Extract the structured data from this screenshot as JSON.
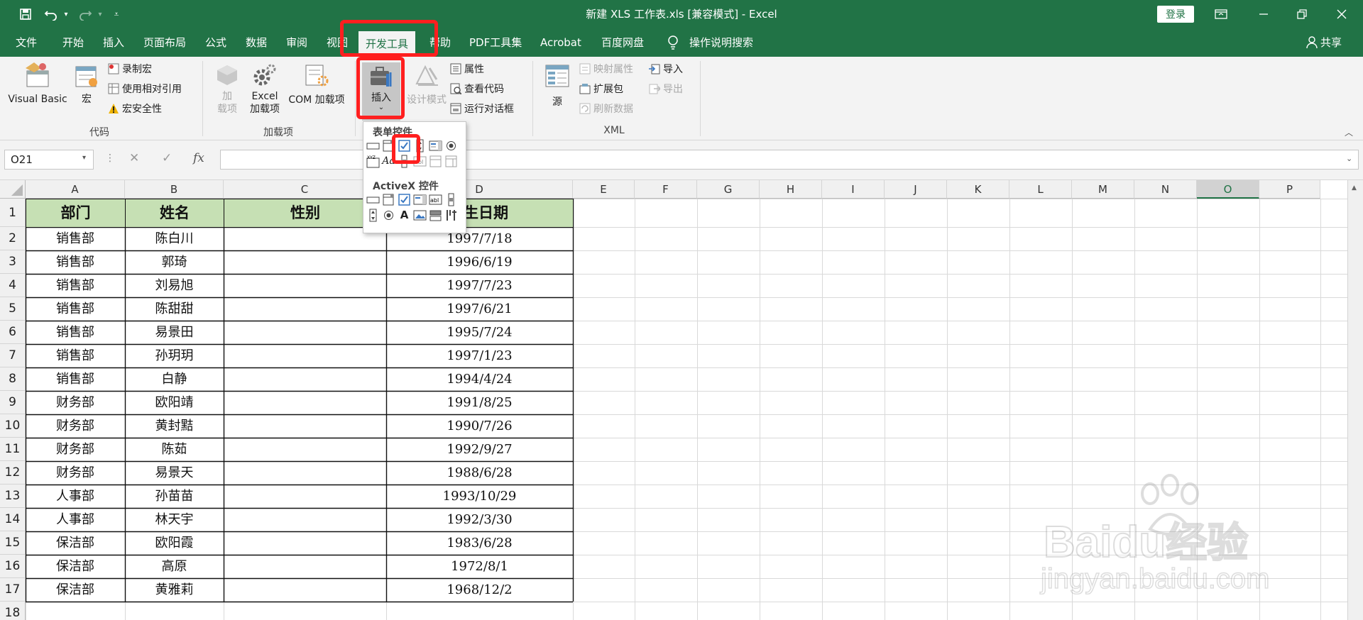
{
  "title_bar": {
    "title": "新建 XLS 工作表.xls  [兼容模式]  -  Excel",
    "login_label": "登录"
  },
  "tabs": [
    "文件",
    "开始",
    "插入",
    "页面布局",
    "公式",
    "数据",
    "审阅",
    "视图",
    "开发工具",
    "帮助",
    "PDF工具集",
    "Acrobat",
    "百度网盘",
    "操作说明搜索"
  ],
  "share_label": "共享",
  "ribbon": {
    "code_group": {
      "label": "代码",
      "visual_basic": "Visual Basic",
      "macro": "宏",
      "record_macro": "录制宏",
      "relative_ref": "使用相对引用",
      "macro_security": "宏安全性"
    },
    "addins_group": {
      "label": "加载项",
      "addins_l1": "加",
      "addins_l2": "载项",
      "excel_addins_l1": "Excel",
      "excel_addins_l2": "加载项",
      "com_addins": "COM 加载项"
    },
    "controls_group": {
      "insert": "插入",
      "design_mode": "设计模式",
      "properties": "属性",
      "view_code": "查看代码",
      "run_dialog": "运行对话框"
    },
    "xml_group": {
      "label": "XML",
      "source": "源",
      "map_properties": "映射属性",
      "expansion_packs": "扩展包",
      "refresh_data": "刷新数据",
      "import": "导入",
      "export": "导出"
    }
  },
  "formula_bar": {
    "name_box": "O21",
    "fx_label": "fx",
    "value": ""
  },
  "insert_menu": {
    "form_controls_title": "表单控件",
    "activex_title": "ActiveX 控件"
  },
  "columns": [
    "A",
    "B",
    "C",
    "D",
    "E",
    "F",
    "G",
    "H",
    "I",
    "J",
    "K",
    "L",
    "M",
    "N",
    "O",
    "P"
  ],
  "selected_column": "O",
  "row_numbers": [
    "1",
    "2",
    "3",
    "4",
    "5",
    "6",
    "7",
    "8",
    "9",
    "10",
    "11",
    "12",
    "13",
    "14",
    "15",
    "16",
    "17",
    "18"
  ],
  "table": {
    "headers": [
      "部门",
      "姓名",
      "性别",
      "出生日期"
    ],
    "header_visible": {
      "D": "生日期"
    },
    "rows": [
      [
        "销售部",
        "陈白川",
        "",
        "1997/7/18"
      ],
      [
        "销售部",
        "郭琦",
        "",
        "1996/6/19"
      ],
      [
        "销售部",
        "刘易旭",
        "",
        "1997/7/23"
      ],
      [
        "销售部",
        "陈甜甜",
        "",
        "1997/6/21"
      ],
      [
        "销售部",
        "易景田",
        "",
        "1995/7/24"
      ],
      [
        "销售部",
        "孙玥玥",
        "",
        "1997/1/23"
      ],
      [
        "销售部",
        "白静",
        "",
        "1994/4/24"
      ],
      [
        "财务部",
        "欧阳靖",
        "",
        "1991/8/25"
      ],
      [
        "财务部",
        "黄封黠",
        "",
        "1990/7/26"
      ],
      [
        "财务部",
        "陈茹",
        "",
        "1992/9/27"
      ],
      [
        "财务部",
        "易景天",
        "",
        "1988/6/28"
      ],
      [
        "人事部",
        "孙苗苗",
        "",
        "1993/10/29"
      ],
      [
        "人事部",
        "林天宇",
        "",
        "1992/3/30"
      ],
      [
        "保洁部",
        "欧阳霞",
        "",
        "1983/6/28"
      ],
      [
        "保洁部",
        "高原",
        "",
        "1972/8/1"
      ],
      [
        "保洁部",
        "黄雅莉",
        "",
        "1968/12/2"
      ]
    ]
  },
  "watermark": {
    "text1": "Bai",
    "text2": "du",
    "text3": "经验",
    "url": "jingyan.baidu.com"
  },
  "colors": {
    "excel_green": "#217346",
    "header_fill": "#c6e0b4",
    "highlight": "#ff1f1f"
  }
}
